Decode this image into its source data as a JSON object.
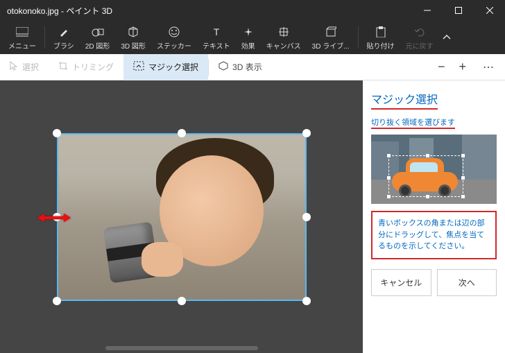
{
  "titlebar": {
    "title": "otokonoko.jpg - ペイント 3D"
  },
  "ribbon": {
    "menu": "メニュー",
    "brush": "ブラシ",
    "shapes2d": "2D 図形",
    "shapes3d": "3D 図形",
    "stickers": "ステッカー",
    "text": "テキスト",
    "effects": "効果",
    "canvas": "キャンバス",
    "lib3d": "3D ライブ...",
    "paste": "貼り付け",
    "undo": "元に戻す"
  },
  "toolbar2": {
    "select": "選択",
    "trimming": "トリミング",
    "magic": "マジック選択",
    "view3d": "3D 表示"
  },
  "sidepanel": {
    "title": "マジック選択",
    "subtitle": "切り抜く領域を選びます",
    "instruction": "青いボックスの角または辺の部分にドラッグして、焦点を当てるものを示してください。",
    "cancel": "キャンセル",
    "next": "次へ"
  }
}
